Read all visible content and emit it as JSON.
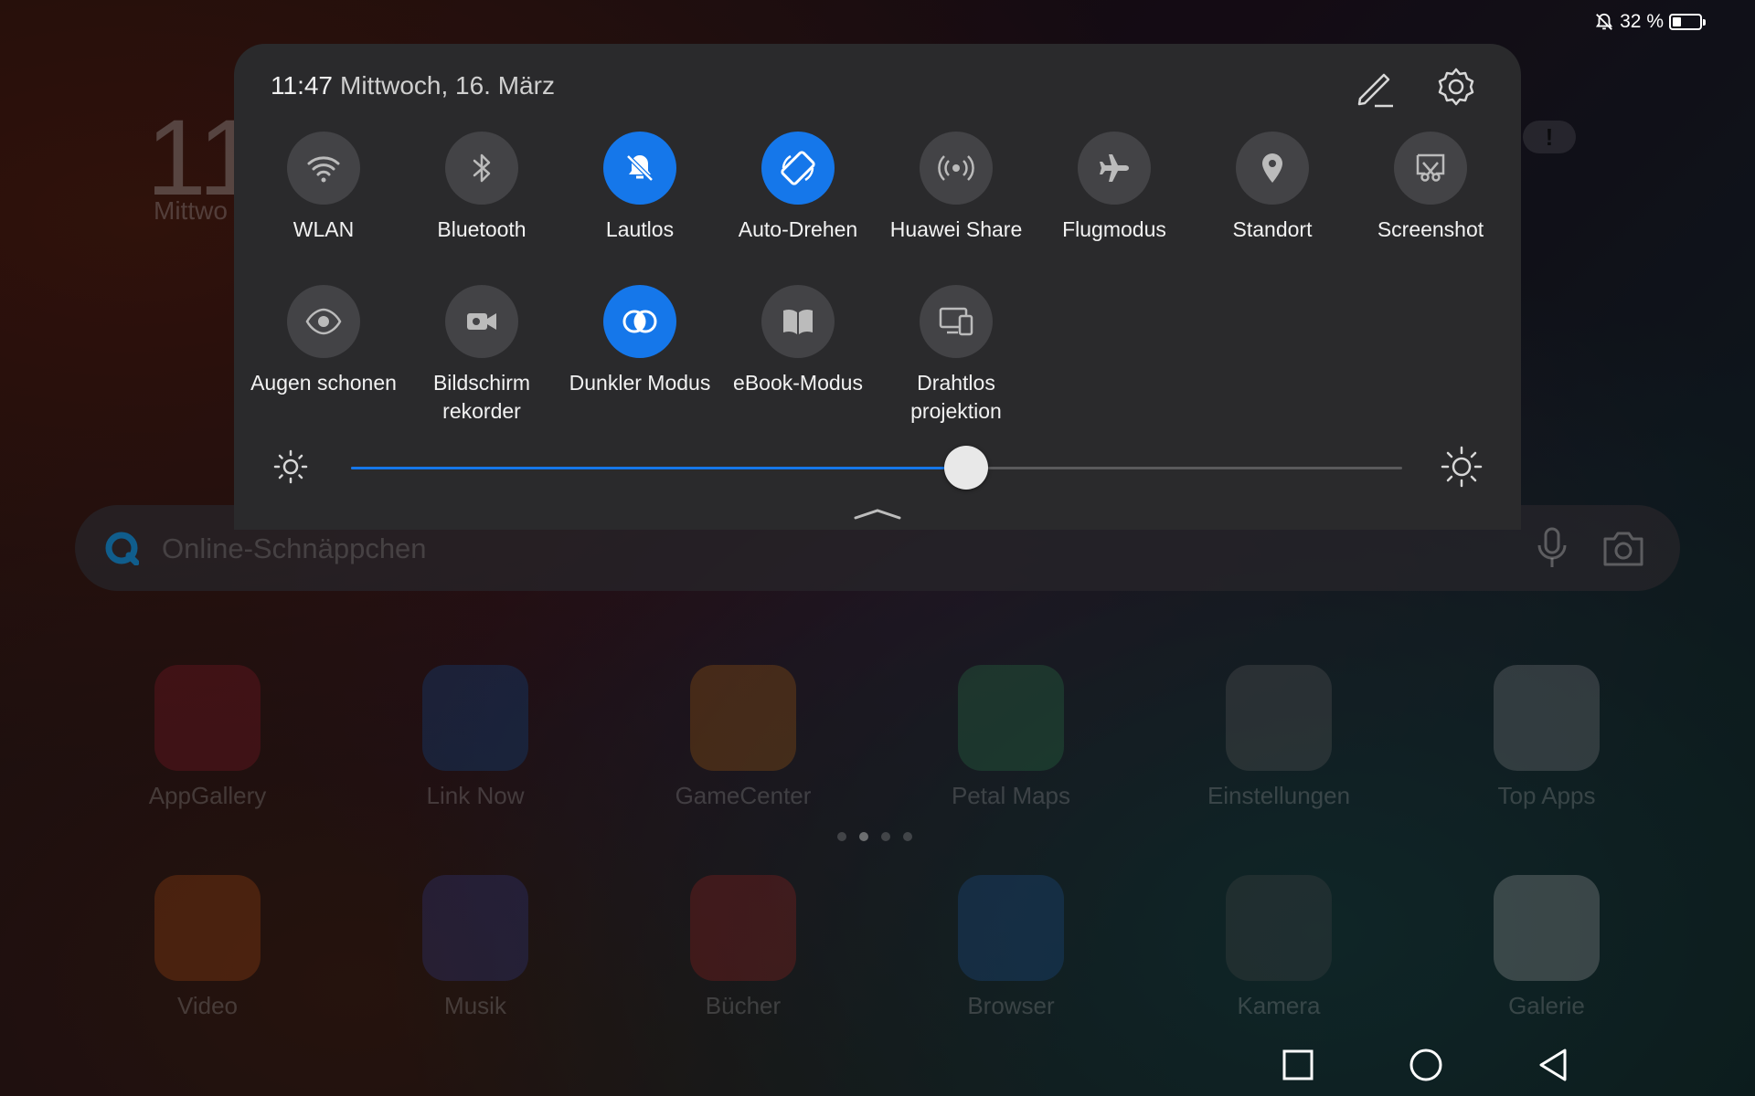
{
  "status_bar": {
    "battery_text": "32 %",
    "battery_level": 0.32,
    "icons": [
      "bell-off-icon",
      "battery-icon"
    ]
  },
  "home": {
    "clock_partial": "11",
    "date_partial": "Mittwo",
    "search": {
      "placeholder": "Online-Schnäppchen",
      "icons": [
        "search-logo-icon",
        "microphone-icon",
        "camera-icon"
      ]
    },
    "apps_row1": [
      {
        "label": "AppGallery",
        "icon": "appgallery-icon",
        "color": "#c8243a"
      },
      {
        "label": "Link Now",
        "icon": "link-now-icon",
        "color": "#1a6fd0"
      },
      {
        "label": "GameCenter",
        "icon": "gamecenter-icon",
        "color": "#f28a1c"
      },
      {
        "label": "Petal Maps",
        "icon": "petal-maps-icon",
        "color": "#3fae6a"
      },
      {
        "label": "Einstellungen",
        "icon": "settings-gear-icon",
        "color": "#8a8a8a"
      },
      {
        "label": "Top Apps",
        "icon": "folder-icon",
        "color": "#bfbfc4"
      }
    ],
    "apps_row2": [
      {
        "label": "Video",
        "icon": "video-icon",
        "color": "#f26a1c"
      },
      {
        "label": "Musik",
        "icon": "music-icon",
        "color": "#4a58c8"
      },
      {
        "label": "Bücher",
        "icon": "books-icon",
        "color": "#e0332e"
      },
      {
        "label": "Browser",
        "icon": "browser-icon",
        "color": "#2a7ad8"
      },
      {
        "label": "Kamera",
        "icon": "camera-app-icon",
        "color": "#6a6a6a"
      },
      {
        "label": "Galerie",
        "icon": "gallery-icon",
        "color": "#e8e8e8"
      }
    ],
    "page_count": 4,
    "active_page": 2
  },
  "panel": {
    "time": "11:47",
    "date": "Mittwoch, 16. März",
    "tiles_row1": [
      {
        "label": "WLAN",
        "icon": "wifi-icon",
        "on": false
      },
      {
        "label": "Bluetooth",
        "icon": "bluetooth-icon",
        "on": false
      },
      {
        "label": "Lautlos",
        "icon": "bell-off-icon",
        "on": true
      },
      {
        "label": "Auto-Drehen",
        "icon": "auto-rotate-icon",
        "on": true
      },
      {
        "label": "Huawei Share",
        "icon": "huawei-share-icon",
        "on": false
      },
      {
        "label": "Flugmodus",
        "icon": "airplane-icon",
        "on": false
      },
      {
        "label": "Standort",
        "icon": "location-pin-icon",
        "on": false
      },
      {
        "label": "Screenshot",
        "icon": "screenshot-icon",
        "on": false
      }
    ],
    "tiles_row2": [
      {
        "label": "Augen schonen",
        "icon": "eye-icon",
        "on": false
      },
      {
        "label": "Bildschirm\nrekorder",
        "icon": "screen-recorder-icon",
        "on": false
      },
      {
        "label": "Dunkler Modus",
        "icon": "dark-mode-icon",
        "on": true
      },
      {
        "label": "eBook-Modus",
        "icon": "ebook-icon",
        "on": false
      },
      {
        "label": "Drahtlos\nprojektion",
        "icon": "wireless-projection-icon",
        "on": false
      }
    ],
    "brightness": 0.585,
    "accent_color": "#1577ea"
  },
  "nav": {
    "buttons": [
      "recents-square-icon",
      "home-circle-icon",
      "back-triangle-icon"
    ]
  }
}
